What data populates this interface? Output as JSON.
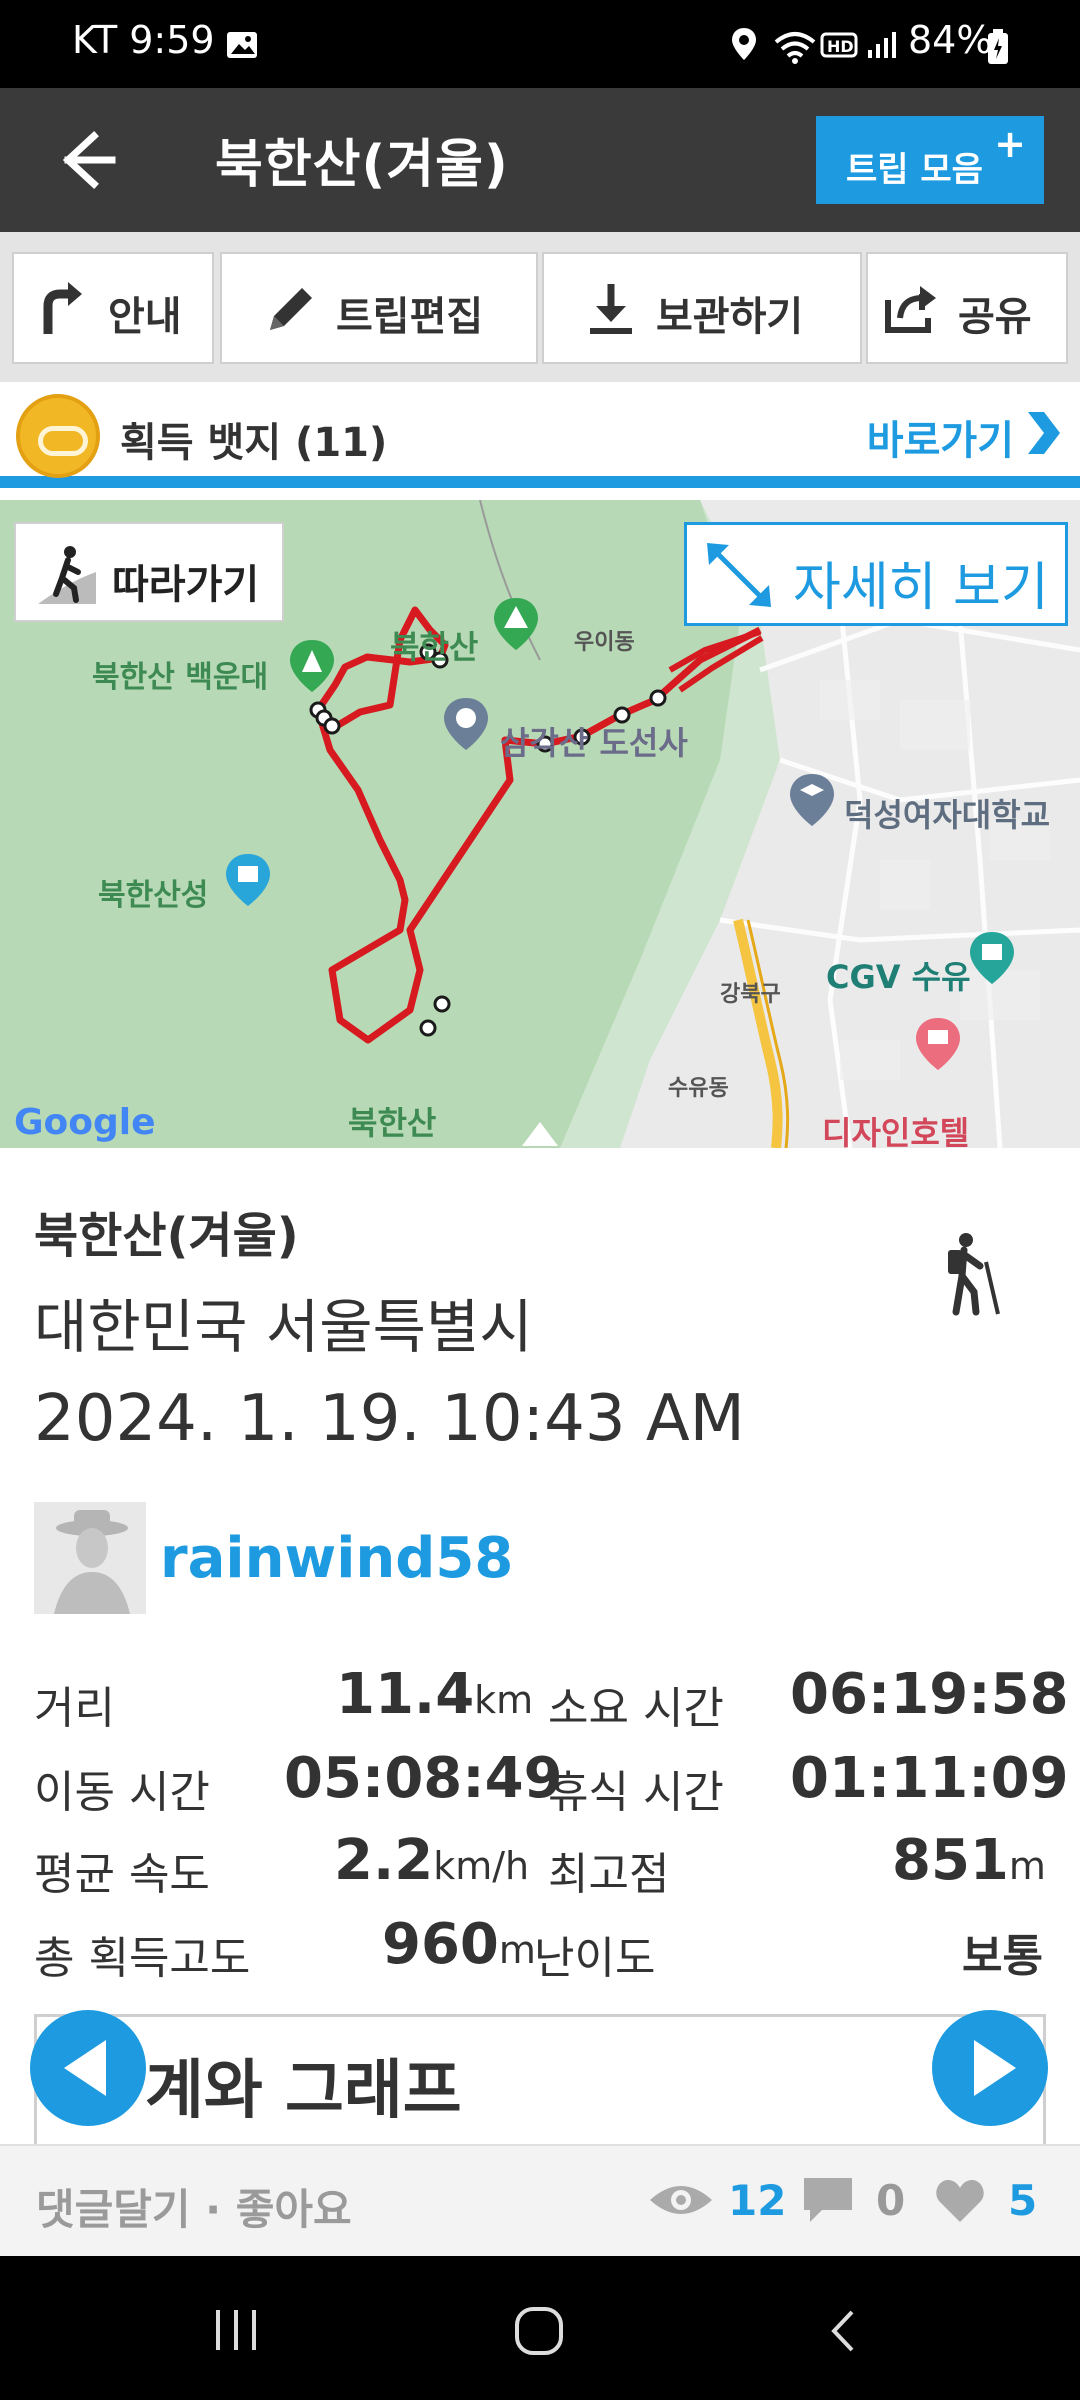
{
  "status_bar": {
    "carrier_time": "KT 9:59",
    "battery": "84%"
  },
  "app_bar": {
    "title": "북한산(겨울)",
    "trip_collection_label": "트립 모음"
  },
  "toolbar": {
    "guide_label": "안내",
    "edit_label": "트립편집",
    "save_label": "보관하기",
    "share_label": "공유"
  },
  "badges": {
    "label": "획득 뱃지 (11)",
    "shortcut_label": "바로가기"
  },
  "map": {
    "follow_label": "따라가기",
    "detail_label": "자세히 보기",
    "labels": {
      "baekundae": "북한산 백운대",
      "bukhansan": "북한산",
      "uidong": "우이동",
      "doseonsa": "삼각산 도선사",
      "bukhansanseong": "북한산성",
      "duksung": "덕성여자대학교",
      "gangbukgu": "강북구",
      "suyu_cgv": "CGV 수유",
      "suyudong": "수유동",
      "design_hotel": "디자인호텔",
      "bukhansan_bottom": "북한산"
    },
    "attribution": "Google"
  },
  "trip": {
    "name": "북한산(겨울)",
    "region": "대한민국 서울특별시",
    "datetime": "2024. 1. 19. 10:43 AM",
    "user": "rainwind58",
    "activity_icon": "hiking-icon"
  },
  "stats": {
    "distance_label": "거리",
    "distance_value": "11.4",
    "distance_unit": "km",
    "duration_label": "소요 시간",
    "duration_value": "06:19:58",
    "moving_label": "이동 시간",
    "moving_value": "05:08:49",
    "rest_label": "휴식 시간",
    "rest_value": "01:11:09",
    "speed_label": "평균 속도",
    "speed_value": "2.2",
    "speed_unit": "km/h",
    "max_alt_label": "최고점",
    "max_alt_value": "851",
    "max_alt_unit": "m",
    "gain_label": "총 획득고도",
    "gain_value": "960",
    "gain_unit": "m",
    "difficulty_label": "난이도",
    "difficulty_value": "보통"
  },
  "graph_section": {
    "title": "계와 그래프"
  },
  "footer": {
    "comment_like": "댓글달기 · 좋아요",
    "views": "12",
    "comments": "0",
    "likes": "5"
  },
  "colors": {
    "accent": "#1e9be0",
    "appbar": "#3a3a3a",
    "route": "#d71920"
  }
}
